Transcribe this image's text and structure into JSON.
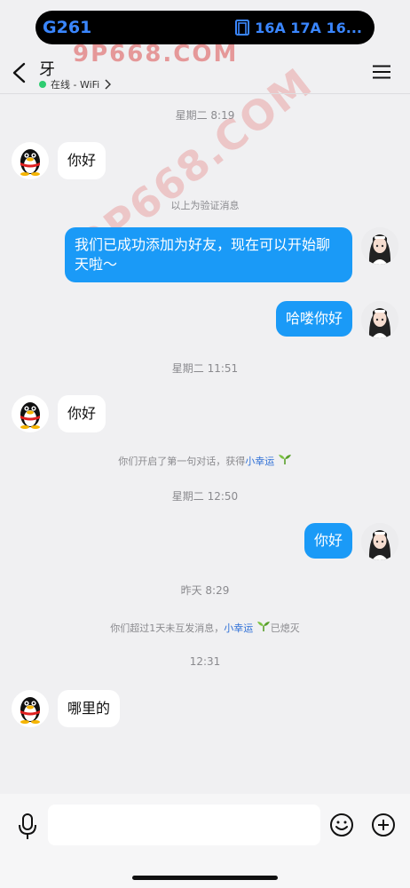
{
  "status_pill": {
    "code": "G261",
    "gates": "16A 17A 16..."
  },
  "watermark": {
    "text": "9P668.COM"
  },
  "header": {
    "contact_name": "牙",
    "presence": "在线 - WiFi"
  },
  "messages": [
    {
      "type": "time",
      "text": "星期二 8:19"
    },
    {
      "type": "in",
      "text": "你好"
    },
    {
      "type": "system",
      "text": "以上为验证消息"
    },
    {
      "type": "out",
      "text": "我们已成功添加为好友，现在可以开始聊天啦～"
    },
    {
      "type": "out",
      "text": "哈喽你好"
    },
    {
      "type": "time",
      "text": "星期二 11:51"
    },
    {
      "type": "in",
      "text": "你好"
    },
    {
      "type": "system",
      "text": "你们开启了第一句对话，获得",
      "highlight": "小幸运"
    },
    {
      "type": "time",
      "text": "星期二 12:50"
    },
    {
      "type": "out",
      "text": "你好"
    },
    {
      "type": "time",
      "text": "昨天 8:29"
    },
    {
      "type": "system",
      "text": "你们超过1天未互发消息，",
      "highlight": "小幸运",
      "suffix": "已熄灭"
    },
    {
      "type": "time",
      "text": "12:31"
    },
    {
      "type": "in",
      "text": "哪里的"
    }
  ],
  "icons": {
    "back": "chevron-left-icon",
    "menu": "menu-icon",
    "voice": "microphone-icon",
    "emoji": "emoji-icon",
    "more": "plus-icon",
    "sprout": "sprout-icon"
  },
  "colors": {
    "bubble_out": "#1a9af7",
    "link": "#2e6fd6",
    "online": "#2ecc71"
  }
}
